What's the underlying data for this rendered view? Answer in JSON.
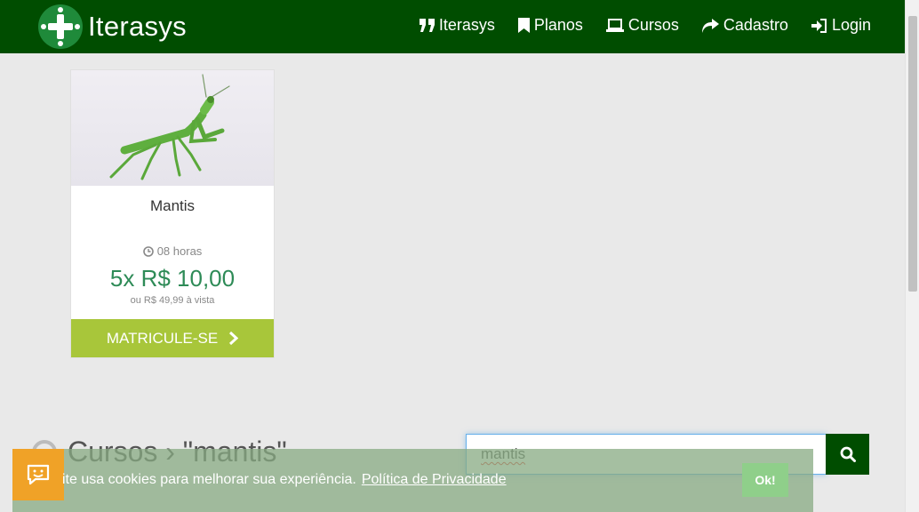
{
  "header": {
    "brand": "Iterasys",
    "nav": [
      {
        "label": "Iterasys",
        "icon": "quote-icon"
      },
      {
        "label": "Planos",
        "icon": "bookmark-icon"
      },
      {
        "label": "Cursos",
        "icon": "laptop-icon"
      },
      {
        "label": "Cadastro",
        "icon": "share-icon"
      },
      {
        "label": "Login",
        "icon": "sign-in-icon"
      }
    ]
  },
  "course": {
    "title": "Mantis",
    "hours": "08 horas",
    "price": "5x R$ 10,00",
    "cash_price": "ou R$ 49,99 à vista",
    "button": "MATRICULE-SE"
  },
  "search": {
    "heading": "Cursos › \"mantis\"",
    "value": "mantis"
  },
  "cookie": {
    "text": "ite usa cookies para melhorar sua experiência.",
    "link": "Política de Privacidade",
    "ok": "Ok!"
  },
  "colors": {
    "header_bg": "#004d00",
    "accent_button": "#a8c63a",
    "price": "#2e8b57",
    "cookie_icon": "#f0a227"
  }
}
